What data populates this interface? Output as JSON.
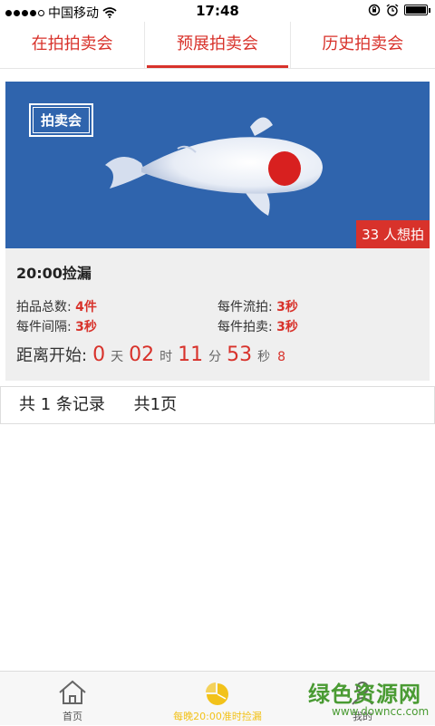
{
  "status_bar": {
    "carrier": "中国移动",
    "time": "17:48"
  },
  "tabs": [
    {
      "label": "在拍拍卖会",
      "active": false
    },
    {
      "label": "预展拍卖会",
      "active": true
    },
    {
      "label": "历史拍卖会",
      "active": false
    }
  ],
  "auction": {
    "banner_badge": "拍卖会",
    "want_count": "33",
    "want_label": "人想拍",
    "title": "20:00捡漏",
    "total_label": "拍品总数:",
    "total_value": "4件",
    "fail_label": "每件流拍:",
    "fail_value": "3秒",
    "interval_label": "每件间隔:",
    "interval_value": "3秒",
    "sell_label": "每件拍卖:",
    "sell_value": "3秒",
    "countdown": {
      "label": "距离开始:",
      "days": "0",
      "days_unit": "天",
      "hours": "02",
      "hours_unit": "时",
      "minutes": "11",
      "minutes_unit": "分",
      "seconds": "53",
      "seconds_unit": "秒",
      "tenths": "8"
    }
  },
  "records": {
    "count_text": "共 1 条记录",
    "pages_text": "共1页"
  },
  "bottom_nav": {
    "home": "首页",
    "center": "每晚20:00准时捡漏",
    "me": "我的"
  },
  "watermark": {
    "cn": "绿色资源网",
    "url": "www.downcc.com"
  },
  "colors": {
    "accent": "#d8322b",
    "banner": "#2f64ad",
    "center_nav": "#f2c21a",
    "watermark": "#4a9b33"
  }
}
